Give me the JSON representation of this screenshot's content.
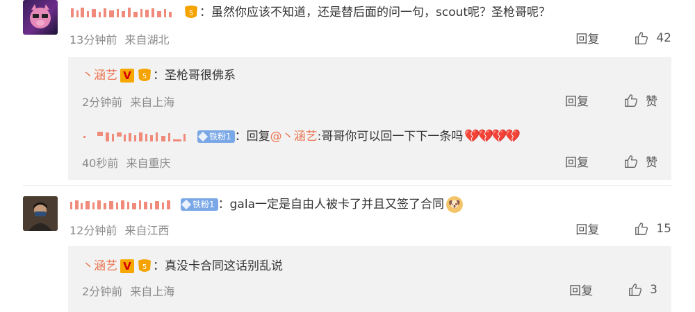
{
  "comments": [
    {
      "text": "：虽然你应该不知道，还是替后面的问一句，scout呢？圣枪哥呢？",
      "time": "13分钟前",
      "location": "来自湖北",
      "reply_label": "回复",
      "likes": "42",
      "replies": [
        {
          "username": "丶涵艺",
          "text": "：圣枪哥很佛系",
          "time": "2分钟前",
          "location": "来自上海",
          "reply_label": "回复",
          "likes": "赞"
        },
        {
          "fan_badge": "铁粉1",
          "text_prefix": "：回复",
          "mention": "@丶涵艺",
          "text": ":哥哥你可以回一下下一条吗",
          "hearts": "💔💔💔💔",
          "time": "40秒前",
          "location": "来自重庆",
          "reply_label": "回复",
          "likes": "赞"
        }
      ]
    },
    {
      "fan_badge": "铁粉1",
      "text": "：gala一定是自由人被卡了并且又签了合同",
      "emoji": "🐶",
      "time": "12分钟前",
      "location": "来自江西",
      "reply_label": "回复",
      "likes": "15",
      "replies": [
        {
          "username": "丶涵艺",
          "text": "：真没卡合同这话别乱说",
          "time": "2分钟前",
          "location": "来自上海",
          "reply_label": "回复",
          "likes": "3"
        }
      ]
    }
  ],
  "icons": {
    "like": "thumbs-up-icon",
    "vip": "v-badge-icon",
    "level": "level-badge-icon"
  },
  "colors": {
    "name_link": "#eb7350",
    "reply_bg": "#f2f2f2",
    "meta": "#8b8b8b",
    "fan_badge": "#7aa7e6"
  }
}
